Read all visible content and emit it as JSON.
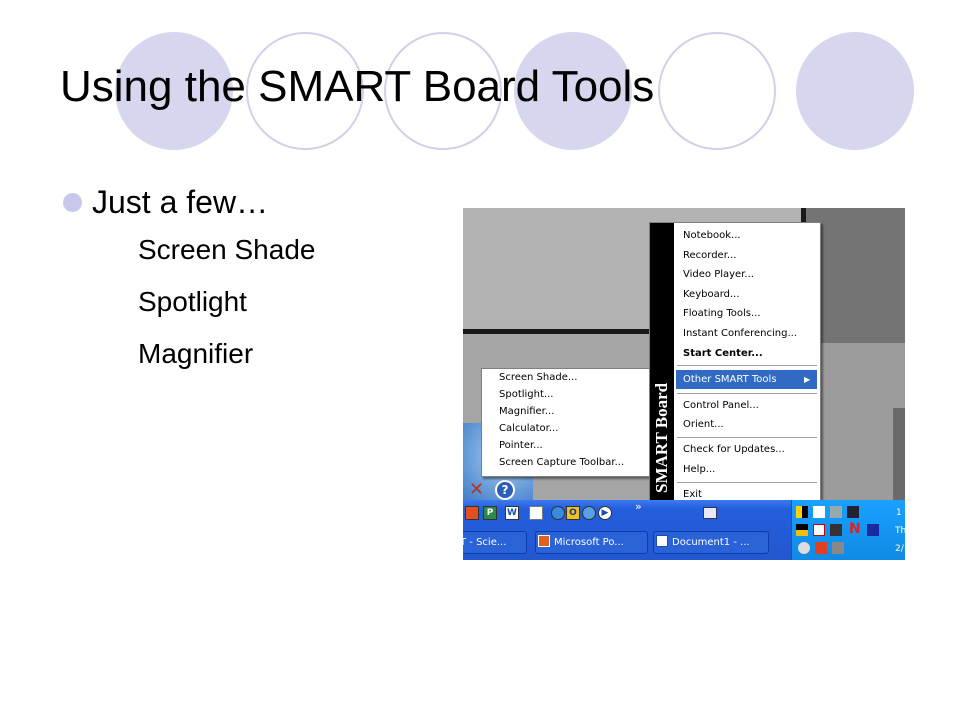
{
  "slide": {
    "title": "Using the SMART Board Tools",
    "bullet": "Just a few…",
    "sub_mark": "",
    "sub_items": [
      "Screen Shade",
      "Spotlight",
      "Magnifier"
    ]
  },
  "screenshot": {
    "main_menu": {
      "brand_text": "SMART Board",
      "items": [
        "Notebook...",
        "Recorder...",
        "Video Player...",
        "Keyboard...",
        "Floating Tools...",
        "Instant Conferencing...",
        "Start Center...",
        "Other SMART Tools",
        "Control Panel...",
        "Orient...",
        "Check for Updates...",
        "Help...",
        "Exit"
      ],
      "submenu_arrow": "▶"
    },
    "sub_menu": {
      "items": [
        "Screen Shade...",
        "Spotlight...",
        "Magnifier...",
        "Calculator...",
        "Pointer...",
        "Screen Capture Toolbar..."
      ]
    },
    "taskbar": {
      "chevron": "»",
      "buttons": [
        "T - Scie...",
        "Microsoft Po...",
        "Document1 - ..."
      ],
      "clock_lines": [
        "1",
        "Th",
        "2/"
      ]
    },
    "colors": {
      "highlight": "#316ac5",
      "taskbar": "#245edb",
      "tray": "#0f8ae4",
      "desktop": "#a5a5a5"
    }
  }
}
